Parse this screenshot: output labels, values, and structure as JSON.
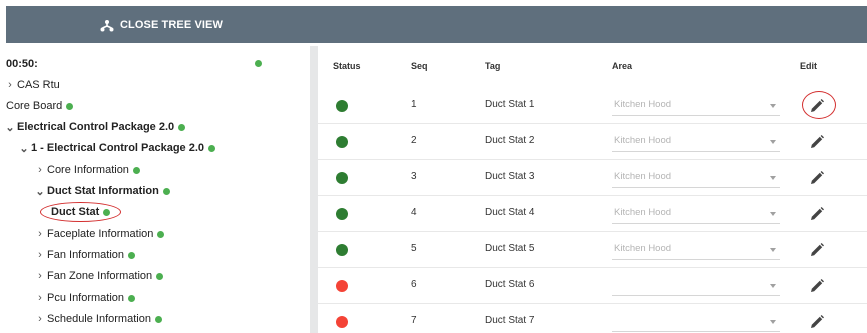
{
  "toolbar": {
    "close_tree_label": "CLOSE TREE VIEW",
    "icon": "tree-structure-icon"
  },
  "tree": {
    "root": {
      "label": "00:50:",
      "status_color": "#4caf50"
    },
    "items": [
      {
        "label": "CAS Rtu",
        "expanded": false,
        "bold": false,
        "has_status": false
      },
      {
        "label": "Core Board",
        "expanded": null,
        "bold": false,
        "has_status": true
      },
      {
        "label": "Electrical Control Package 2.0",
        "expanded": true,
        "bold": true,
        "has_status": true
      },
      {
        "label": "1 - Electrical Control Package 2.0",
        "expanded": true,
        "bold": true,
        "has_status": true
      },
      {
        "label": "Core Information",
        "expanded": false,
        "bold": false,
        "has_status": true
      },
      {
        "label": "Duct Stat Information",
        "expanded": true,
        "bold": true,
        "has_status": true
      },
      {
        "label": "Duct Stat",
        "expanded": null,
        "bold": true,
        "has_status": true,
        "selected": true
      },
      {
        "label": "Faceplate Information",
        "expanded": false,
        "bold": false,
        "has_status": true
      },
      {
        "label": "Fan Information",
        "expanded": false,
        "bold": false,
        "has_status": true
      },
      {
        "label": "Fan Zone Information",
        "expanded": false,
        "bold": false,
        "has_status": true
      },
      {
        "label": "Pcu Information",
        "expanded": false,
        "bold": false,
        "has_status": true
      },
      {
        "label": "Schedule Information",
        "expanded": false,
        "bold": false,
        "has_status": true
      }
    ]
  },
  "table": {
    "columns": {
      "status": "Status",
      "seq": "Seq",
      "tag": "Tag",
      "area": "Area",
      "edit": "Edit"
    },
    "rows": [
      {
        "status": "green",
        "seq": "1",
        "tag": "Duct Stat 1",
        "area": "Kitchen Hood"
      },
      {
        "status": "green",
        "seq": "2",
        "tag": "Duct Stat 2",
        "area": "Kitchen Hood"
      },
      {
        "status": "green",
        "seq": "3",
        "tag": "Duct Stat 3",
        "area": "Kitchen Hood"
      },
      {
        "status": "green",
        "seq": "4",
        "tag": "Duct Stat 4",
        "area": "Kitchen Hood"
      },
      {
        "status": "green",
        "seq": "5",
        "tag": "Duct Stat 5",
        "area": "Kitchen Hood"
      },
      {
        "status": "red",
        "seq": "6",
        "tag": "Duct Stat 6",
        "area": ""
      },
      {
        "status": "red",
        "seq": "7",
        "tag": "Duct Stat 7",
        "area": ""
      }
    ]
  },
  "colors": {
    "toolbar_bg": "#5f6f7d",
    "status_green": "#2e7d32",
    "status_red": "#f44336",
    "tree_status_green": "#4caf50",
    "highlight_ring": "#d32f2f"
  }
}
